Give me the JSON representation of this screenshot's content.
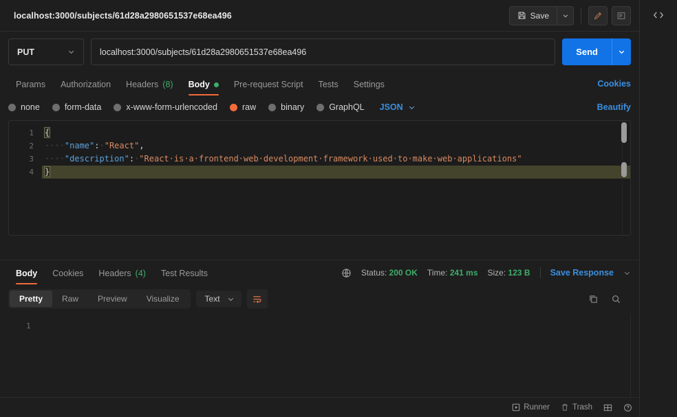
{
  "header": {
    "request_title": "localhost:3000/subjects/61d28a2980651537e68ea496",
    "save_label": "Save",
    "save_icon": "floppy-disk-icon",
    "save_caret_icon": "chevron-down-icon",
    "comment_icon": "pencil-icon",
    "documentation_icon": "document-icon",
    "code_icon": "code-brackets-icon"
  },
  "url_bar": {
    "method": "PUT",
    "method_caret_icon": "chevron-down-icon",
    "url": "localhost:3000/subjects/61d28a2980651537e68ea496",
    "send_label": "Send",
    "send_caret_icon": "chevron-down-icon",
    "send_color": "#1273e6"
  },
  "request_tabs": {
    "items": [
      {
        "label": "Params",
        "active": false
      },
      {
        "label": "Authorization",
        "active": false
      },
      {
        "label": "Headers",
        "count": "(8)",
        "active": false
      },
      {
        "label": "Body",
        "dot": true,
        "active": true
      },
      {
        "label": "Pre-request Script",
        "active": false
      },
      {
        "label": "Tests",
        "active": false
      },
      {
        "label": "Settings",
        "active": false
      }
    ],
    "cookies_link": "Cookies",
    "active_underline_color": "#f26b3a",
    "count_color": "#3fae6a"
  },
  "body_type": {
    "options": [
      {
        "label": "none",
        "selected": false
      },
      {
        "label": "form-data",
        "selected": false
      },
      {
        "label": "x-www-form-urlencoded",
        "selected": false
      },
      {
        "label": "raw",
        "selected": true
      },
      {
        "label": "binary",
        "selected": false
      },
      {
        "label": "GraphQL",
        "selected": false
      }
    ],
    "format": "JSON",
    "format_caret_icon": "chevron-down-icon",
    "beautify_link": "Beautify",
    "selected_color": "#f26b3a",
    "link_color": "#3a8fe0"
  },
  "editor": {
    "lines": [
      {
        "num": "1",
        "content": "{",
        "active": false
      },
      {
        "num": "2",
        "content": "    \"name\": \"React\",",
        "active": false
      },
      {
        "num": "3",
        "content": "    \"description\": \"React is a frontend web development framework used to make web applications\"",
        "active": false
      },
      {
        "num": "4",
        "content": "}",
        "active": true
      }
    ],
    "json": {
      "name": "React",
      "description": "React is a frontend web development framework used to make web applications"
    },
    "key_color": "#5ba2dd",
    "string_color": "#d98a62",
    "active_line_color": "#44442c"
  },
  "response": {
    "tabs": [
      {
        "label": "Body",
        "active": true
      },
      {
        "label": "Cookies",
        "active": false
      },
      {
        "label": "Headers",
        "count": "(4)",
        "active": false
      },
      {
        "label": "Test Results",
        "active": false
      }
    ],
    "globe_icon": "globe-icon",
    "status_label": "Status:",
    "status_value": "200 OK",
    "time_label": "Time:",
    "time_value": "241 ms",
    "size_label": "Size:",
    "size_value": "123 B",
    "save_response_label": "Save Response",
    "save_response_caret_icon": "chevron-down-icon",
    "view_modes": [
      {
        "label": "Pretty",
        "active": true
      },
      {
        "label": "Raw",
        "active": false
      },
      {
        "label": "Preview",
        "active": false
      },
      {
        "label": "Visualize",
        "active": false
      }
    ],
    "format": "Text",
    "format_caret_icon": "chevron-down-icon",
    "wrap_icon": "wrap-lines-icon",
    "copy_icon": "copy-icon",
    "search_icon": "search-icon",
    "body_lines": [
      {
        "num": "1",
        "content": ""
      }
    ]
  },
  "status_bar": {
    "runner_label": "Runner",
    "runner_icon": "play-square-icon",
    "trash_label": "Trash",
    "trash_icon": "trash-icon",
    "layout_icon": "two-pane-layout-icon",
    "help_icon": "question-circle-icon"
  }
}
